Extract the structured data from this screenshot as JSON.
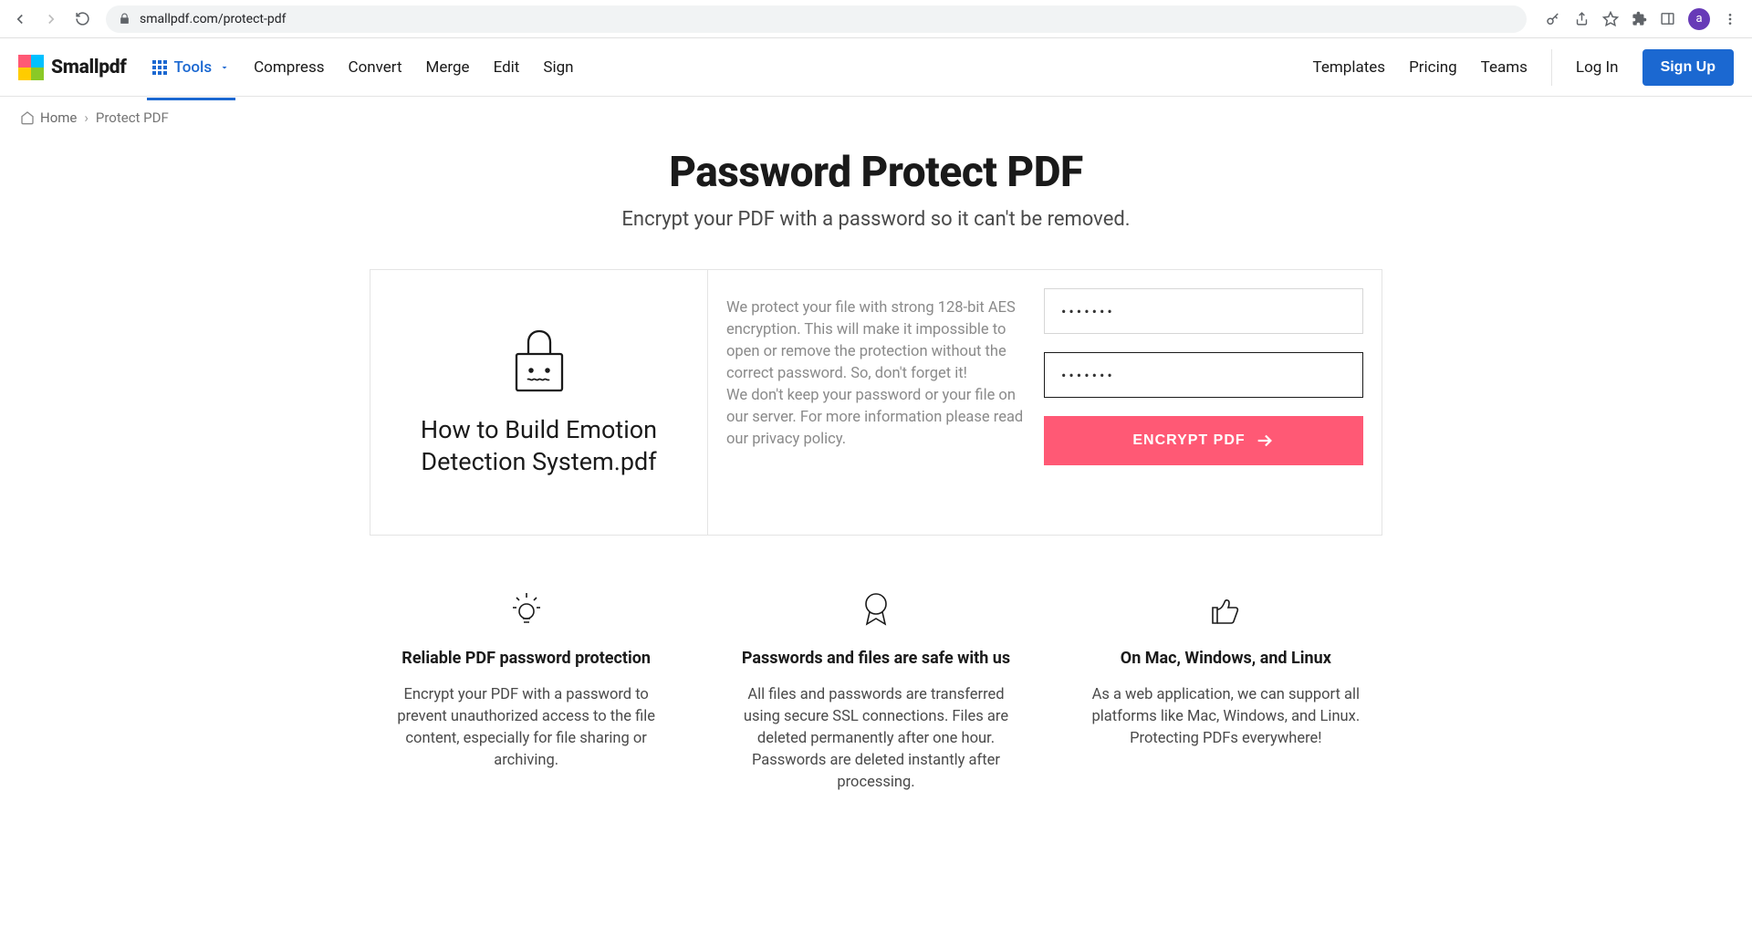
{
  "browser": {
    "url": "smallpdf.com/protect-pdf",
    "avatar_letter": "a"
  },
  "header": {
    "brand": "Smallpdf",
    "tools_label": "Tools",
    "nav": [
      "Compress",
      "Convert",
      "Merge",
      "Edit",
      "Sign"
    ],
    "right_nav": [
      "Templates",
      "Pricing",
      "Teams"
    ],
    "login_label": "Log In",
    "signup_label": "Sign Up"
  },
  "breadcrumb": {
    "home_label": "Home",
    "current": "Protect PDF"
  },
  "hero": {
    "title": "Password Protect PDF",
    "subtitle": "Encrypt your PDF with a password so it can't be removed."
  },
  "card": {
    "file_name": "How to Build Emotion Detection System.pdf",
    "description_1": "We protect your file with strong 128-bit AES encryption. This will make it impossible to open or remove the protection without the correct password. So, don't forget it!",
    "description_2": "We don't keep your password or your file on our server. For more information please read our privacy policy.",
    "password1_value": "•••••••",
    "password2_value": "•••••••",
    "encrypt_label": "ENCRYPT PDF"
  },
  "features": [
    {
      "title": "Reliable PDF password protection",
      "body": "Encrypt your PDF with a password to prevent unauthorized access to the file content, especially for file sharing or archiving."
    },
    {
      "title": "Passwords and files are safe with us",
      "body": "All files and passwords are transferred using secure SSL connections. Files are deleted permanently after one hour. Passwords are deleted instantly after processing."
    },
    {
      "title": "On Mac, Windows, and Linux",
      "body": "As a web application, we can support all platforms like Mac, Windows, and Linux. Protecting PDFs everywhere!"
    }
  ]
}
